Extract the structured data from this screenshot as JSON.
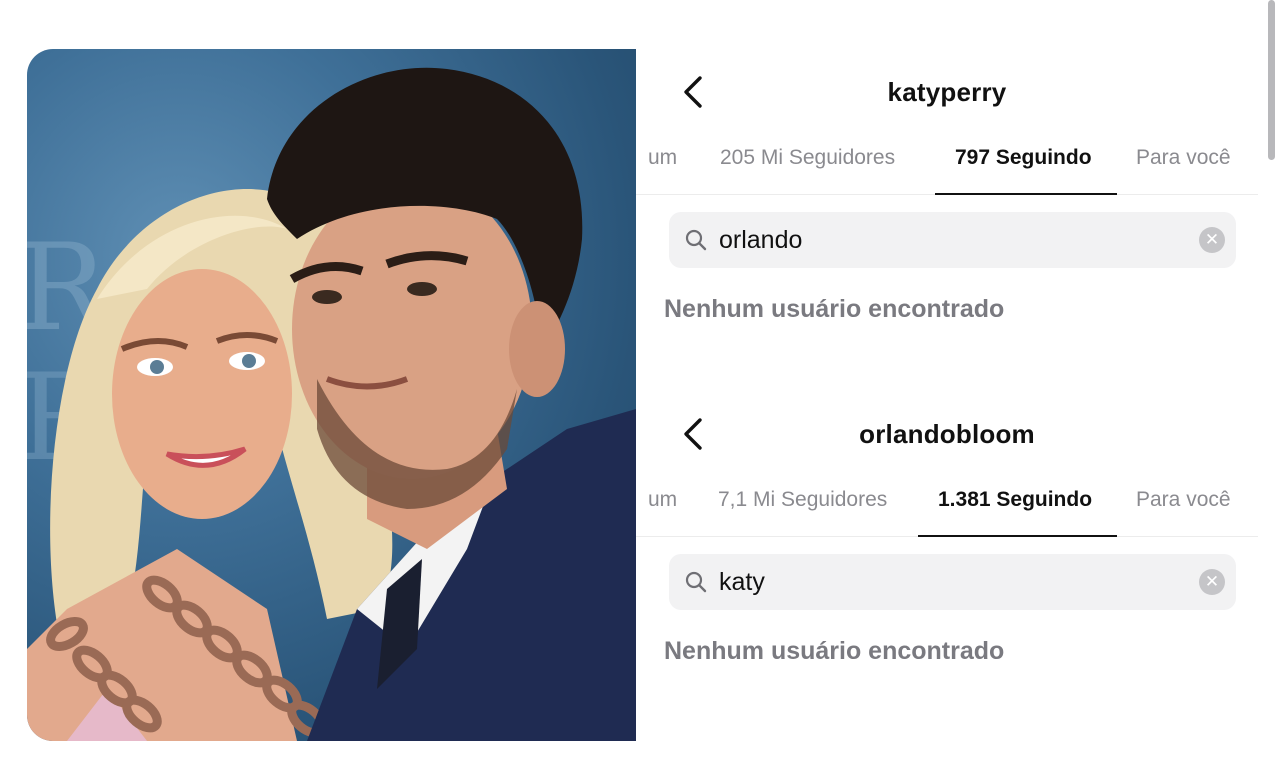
{
  "screens": [
    {
      "username": "katyperry",
      "tabs": [
        {
          "label": "um",
          "active": false
        },
        {
          "label": "205 Mi Seguidores",
          "active": false
        },
        {
          "label": "797 Seguindo",
          "active": true
        },
        {
          "label": "Para você",
          "active": false
        }
      ],
      "search": {
        "value": "orlando"
      },
      "empty_message": "Nenhum usuário encontrado"
    },
    {
      "username": "orlandobloom",
      "tabs": [
        {
          "label": "um",
          "active": false
        },
        {
          "label": "7,1 Mi Seguidores",
          "active": false
        },
        {
          "label": "1.381 Seguindo",
          "active": true
        },
        {
          "label": "Para você",
          "active": false
        }
      ],
      "search": {
        "value": "katy"
      },
      "empty_message": "Nenhum usuário encontrado"
    }
  ],
  "icons": {
    "back": "chevron-left-icon",
    "search": "search-icon",
    "clear": "clear-icon"
  },
  "colors": {
    "text_primary": "#111111",
    "text_secondary": "#8a8a8f",
    "search_bg": "#f2f2f3",
    "photo_backdrop": "#3f7098"
  }
}
